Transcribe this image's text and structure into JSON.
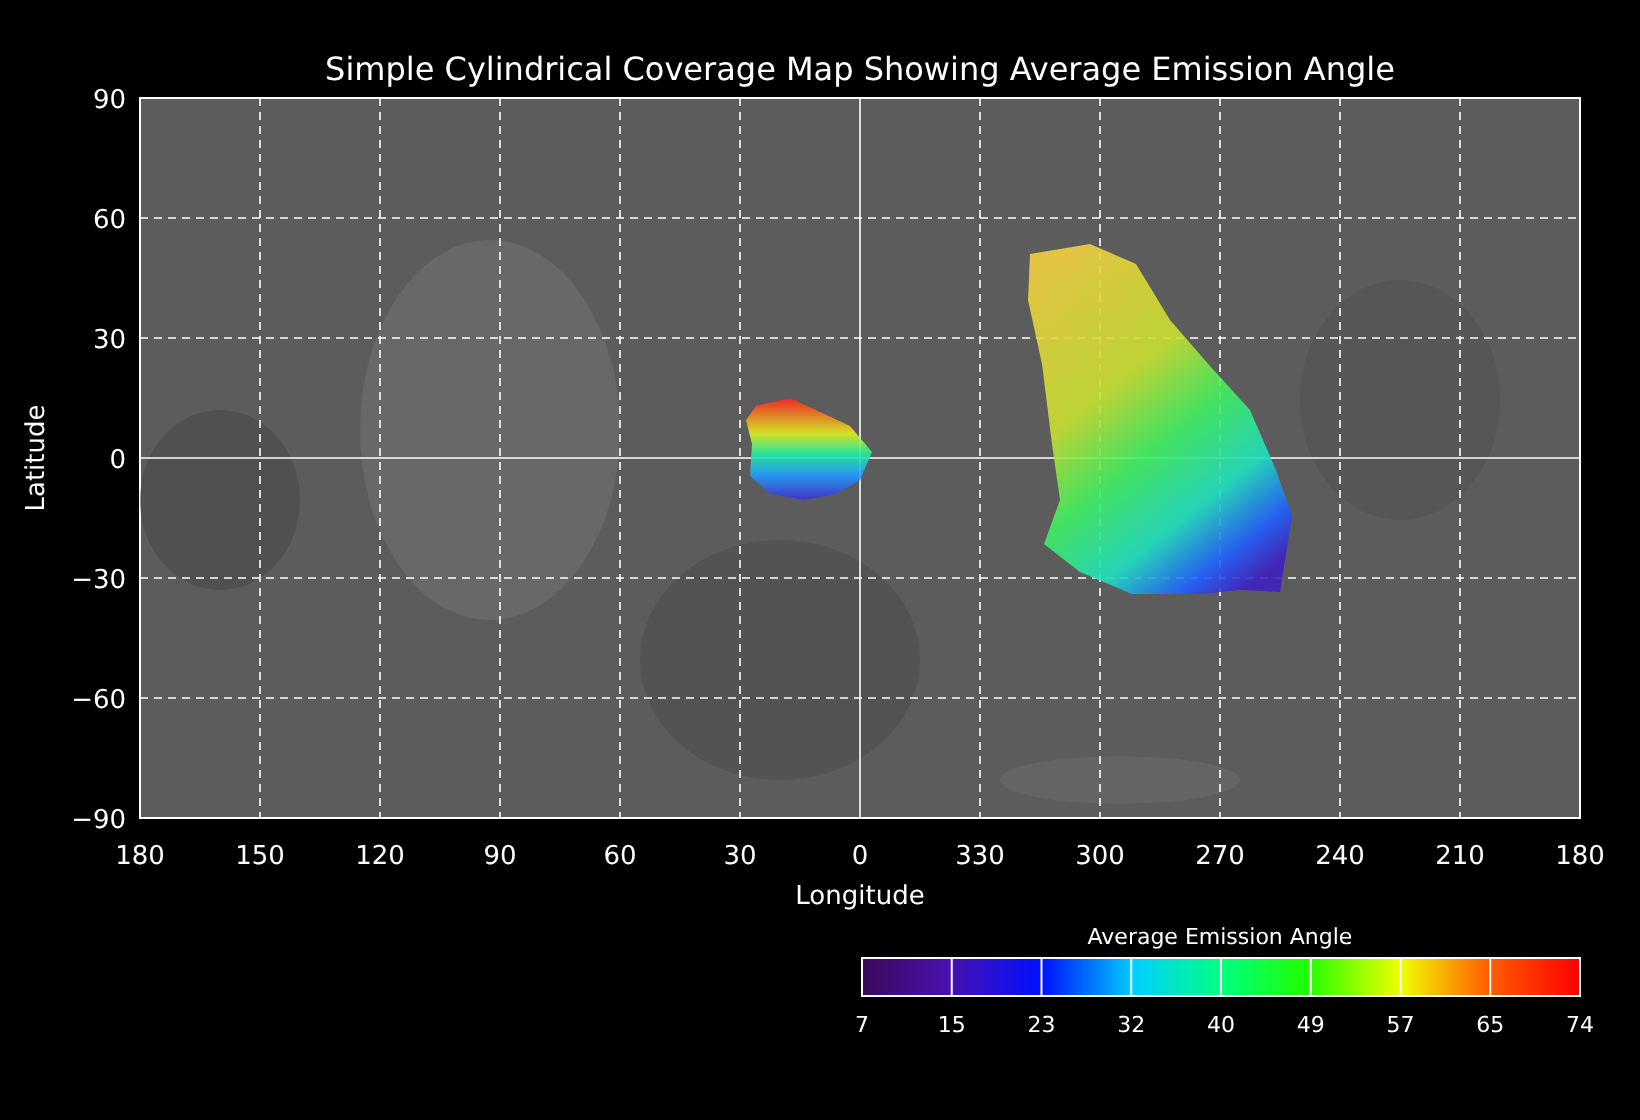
{
  "title": "Simple Cylindrical Coverage Map Showing Average Emission Angle",
  "map": {
    "xlabel": "Longitude",
    "ylabel": "Latitude",
    "xticks": [
      "180",
      "150",
      "120",
      "90",
      "60",
      "30",
      "0",
      "330",
      "300",
      "270",
      "240",
      "210",
      "180"
    ],
    "yticks": [
      "90",
      "60",
      "30",
      "0",
      "−30",
      "−60",
      "−90"
    ]
  },
  "colorbar": {
    "title": "Average Emission Angle",
    "ticks": [
      "7",
      "15",
      "23",
      "32",
      "40",
      "49",
      "57",
      "65",
      "74"
    ]
  }
}
